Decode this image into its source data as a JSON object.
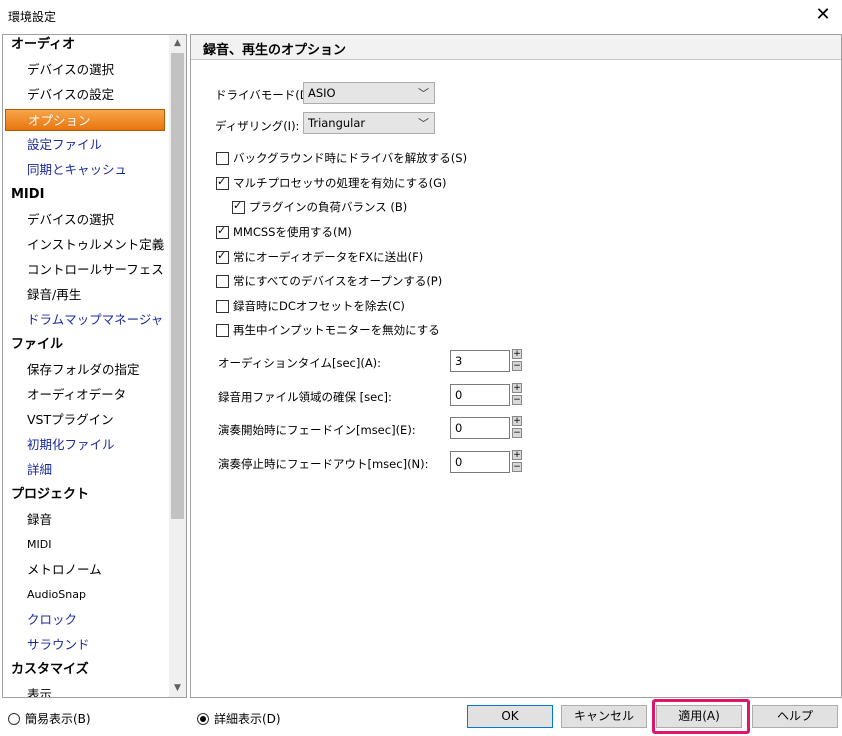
{
  "window": {
    "title": "環境設定",
    "close_icon": "close-icon"
  },
  "sidebar": {
    "items": [
      {
        "label": "オーディオ",
        "type": "category"
      },
      {
        "label": "デバイスの選択",
        "type": "item"
      },
      {
        "label": "デバイスの設定",
        "type": "item"
      },
      {
        "label": "オプション",
        "type": "item",
        "selected": true
      },
      {
        "label": "設定ファイル",
        "type": "link"
      },
      {
        "label": "同期とキャッシュ",
        "type": "link"
      },
      {
        "label": "MIDI",
        "type": "category"
      },
      {
        "label": "デバイスの選択",
        "type": "item"
      },
      {
        "label": "インストゥルメント定義",
        "type": "item"
      },
      {
        "label": "コントロールサーフェス",
        "type": "item"
      },
      {
        "label": "録音/再生",
        "type": "item"
      },
      {
        "label": "ドラムマップマネージャ",
        "type": "link"
      },
      {
        "label": "ファイル",
        "type": "category"
      },
      {
        "label": "保存フォルダの指定",
        "type": "item"
      },
      {
        "label": "オーディオデータ",
        "type": "item"
      },
      {
        "label": "VSTプラグイン",
        "type": "item"
      },
      {
        "label": "初期化ファイル",
        "type": "link"
      },
      {
        "label": "詳細",
        "type": "link"
      },
      {
        "label": "プロジェクト",
        "type": "category"
      },
      {
        "label": "録音",
        "type": "item"
      },
      {
        "label": "MIDI",
        "type": "item"
      },
      {
        "label": "メトロノーム",
        "type": "item"
      },
      {
        "label": "AudioSnap",
        "type": "item"
      },
      {
        "label": "クロック",
        "type": "link"
      },
      {
        "label": "サラウンド",
        "type": "link"
      },
      {
        "label": "カスタマイズ",
        "type": "category"
      },
      {
        "label": "表示",
        "type": "item"
      }
    ]
  },
  "panel": {
    "title": "録音、再生のオプション",
    "driver_mode": {
      "label": "ドライバモード(D):",
      "value": "ASIO"
    },
    "dithering": {
      "label": "ディザリング(I):",
      "value": "Triangular"
    },
    "checkboxes": [
      {
        "label": "バックグラウンド時にドライバを解放する(S)",
        "checked": false,
        "indent": false
      },
      {
        "label": "マルチプロセッサの処理を有効にする(G)",
        "checked": true,
        "indent": false
      },
      {
        "label": "プラグインの負荷バランス (B)",
        "checked": true,
        "indent": true
      },
      {
        "label": "MMCSSを使用する(M)",
        "checked": true,
        "indent": false
      },
      {
        "label": "常にオーディオデータをFXに送出(F)",
        "checked": true,
        "indent": false
      },
      {
        "label": "常にすべてのデバイスをオープンする(P)",
        "checked": false,
        "indent": false
      },
      {
        "label": "録音時にDCオフセットを除去(C)",
        "checked": false,
        "indent": false
      },
      {
        "label": "再生中インプットモニターを無効にする",
        "checked": false,
        "indent": false
      }
    ],
    "numeric_fields": [
      {
        "label": "オーディションタイム[sec](A):",
        "value": "3"
      },
      {
        "label": "録音用ファイル領域の確保 [sec]:",
        "value": "0"
      },
      {
        "label": "演奏開始時にフェードイン[msec](E):",
        "value": "0"
      },
      {
        "label": "演奏停止時にフェードアウト[msec](N):",
        "value": "0"
      }
    ]
  },
  "footer": {
    "radio_simple": "簡易表示(B)",
    "radio_detail": "詳細表示(D)",
    "ok": "OK",
    "cancel": "キャンセル",
    "apply": "適用(A)",
    "help": "ヘルプ"
  },
  "colors": {
    "selection": "#f08c2c",
    "link": "#1a2b9c",
    "highlight": "#e0156b"
  }
}
